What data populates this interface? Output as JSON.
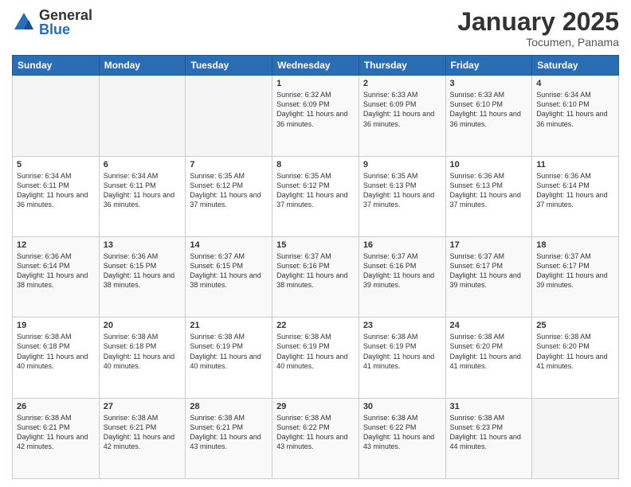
{
  "header": {
    "logo_general": "General",
    "logo_blue": "Blue",
    "month_title": "January 2025",
    "subtitle": "Tocumen, Panama"
  },
  "days_of_week": [
    "Sunday",
    "Monday",
    "Tuesday",
    "Wednesday",
    "Thursday",
    "Friday",
    "Saturday"
  ],
  "weeks": [
    [
      {
        "day": "",
        "info": ""
      },
      {
        "day": "",
        "info": ""
      },
      {
        "day": "",
        "info": ""
      },
      {
        "day": "1",
        "info": "Sunrise: 6:32 AM\nSunset: 6:09 PM\nDaylight: 11 hours and 36 minutes."
      },
      {
        "day": "2",
        "info": "Sunrise: 6:33 AM\nSunset: 6:09 PM\nDaylight: 11 hours and 36 minutes."
      },
      {
        "day": "3",
        "info": "Sunrise: 6:33 AM\nSunset: 6:10 PM\nDaylight: 11 hours and 36 minutes."
      },
      {
        "day": "4",
        "info": "Sunrise: 6:34 AM\nSunset: 6:10 PM\nDaylight: 11 hours and 36 minutes."
      }
    ],
    [
      {
        "day": "5",
        "info": "Sunrise: 6:34 AM\nSunset: 6:11 PM\nDaylight: 11 hours and 36 minutes."
      },
      {
        "day": "6",
        "info": "Sunrise: 6:34 AM\nSunset: 6:11 PM\nDaylight: 11 hours and 36 minutes."
      },
      {
        "day": "7",
        "info": "Sunrise: 6:35 AM\nSunset: 6:12 PM\nDaylight: 11 hours and 37 minutes."
      },
      {
        "day": "8",
        "info": "Sunrise: 6:35 AM\nSunset: 6:12 PM\nDaylight: 11 hours and 37 minutes."
      },
      {
        "day": "9",
        "info": "Sunrise: 6:35 AM\nSunset: 6:13 PM\nDaylight: 11 hours and 37 minutes."
      },
      {
        "day": "10",
        "info": "Sunrise: 6:36 AM\nSunset: 6:13 PM\nDaylight: 11 hours and 37 minutes."
      },
      {
        "day": "11",
        "info": "Sunrise: 6:36 AM\nSunset: 6:14 PM\nDaylight: 11 hours and 37 minutes."
      }
    ],
    [
      {
        "day": "12",
        "info": "Sunrise: 6:36 AM\nSunset: 6:14 PM\nDaylight: 11 hours and 38 minutes."
      },
      {
        "day": "13",
        "info": "Sunrise: 6:36 AM\nSunset: 6:15 PM\nDaylight: 11 hours and 38 minutes."
      },
      {
        "day": "14",
        "info": "Sunrise: 6:37 AM\nSunset: 6:15 PM\nDaylight: 11 hours and 38 minutes."
      },
      {
        "day": "15",
        "info": "Sunrise: 6:37 AM\nSunset: 6:16 PM\nDaylight: 11 hours and 38 minutes."
      },
      {
        "day": "16",
        "info": "Sunrise: 6:37 AM\nSunset: 6:16 PM\nDaylight: 11 hours and 39 minutes."
      },
      {
        "day": "17",
        "info": "Sunrise: 6:37 AM\nSunset: 6:17 PM\nDaylight: 11 hours and 39 minutes."
      },
      {
        "day": "18",
        "info": "Sunrise: 6:37 AM\nSunset: 6:17 PM\nDaylight: 11 hours and 39 minutes."
      }
    ],
    [
      {
        "day": "19",
        "info": "Sunrise: 6:38 AM\nSunset: 6:18 PM\nDaylight: 11 hours and 40 minutes."
      },
      {
        "day": "20",
        "info": "Sunrise: 6:38 AM\nSunset: 6:18 PM\nDaylight: 11 hours and 40 minutes."
      },
      {
        "day": "21",
        "info": "Sunrise: 6:38 AM\nSunset: 6:19 PM\nDaylight: 11 hours and 40 minutes."
      },
      {
        "day": "22",
        "info": "Sunrise: 6:38 AM\nSunset: 6:19 PM\nDaylight: 11 hours and 40 minutes."
      },
      {
        "day": "23",
        "info": "Sunrise: 6:38 AM\nSunset: 6:19 PM\nDaylight: 11 hours and 41 minutes."
      },
      {
        "day": "24",
        "info": "Sunrise: 6:38 AM\nSunset: 6:20 PM\nDaylight: 11 hours and 41 minutes."
      },
      {
        "day": "25",
        "info": "Sunrise: 6:38 AM\nSunset: 6:20 PM\nDaylight: 11 hours and 41 minutes."
      }
    ],
    [
      {
        "day": "26",
        "info": "Sunrise: 6:38 AM\nSunset: 6:21 PM\nDaylight: 11 hours and 42 minutes."
      },
      {
        "day": "27",
        "info": "Sunrise: 6:38 AM\nSunset: 6:21 PM\nDaylight: 11 hours and 42 minutes."
      },
      {
        "day": "28",
        "info": "Sunrise: 6:38 AM\nSunset: 6:21 PM\nDaylight: 11 hours and 43 minutes."
      },
      {
        "day": "29",
        "info": "Sunrise: 6:38 AM\nSunset: 6:22 PM\nDaylight: 11 hours and 43 minutes."
      },
      {
        "day": "30",
        "info": "Sunrise: 6:38 AM\nSunset: 6:22 PM\nDaylight: 11 hours and 43 minutes."
      },
      {
        "day": "31",
        "info": "Sunrise: 6:38 AM\nSunset: 6:23 PM\nDaylight: 11 hours and 44 minutes."
      },
      {
        "day": "",
        "info": ""
      }
    ]
  ]
}
